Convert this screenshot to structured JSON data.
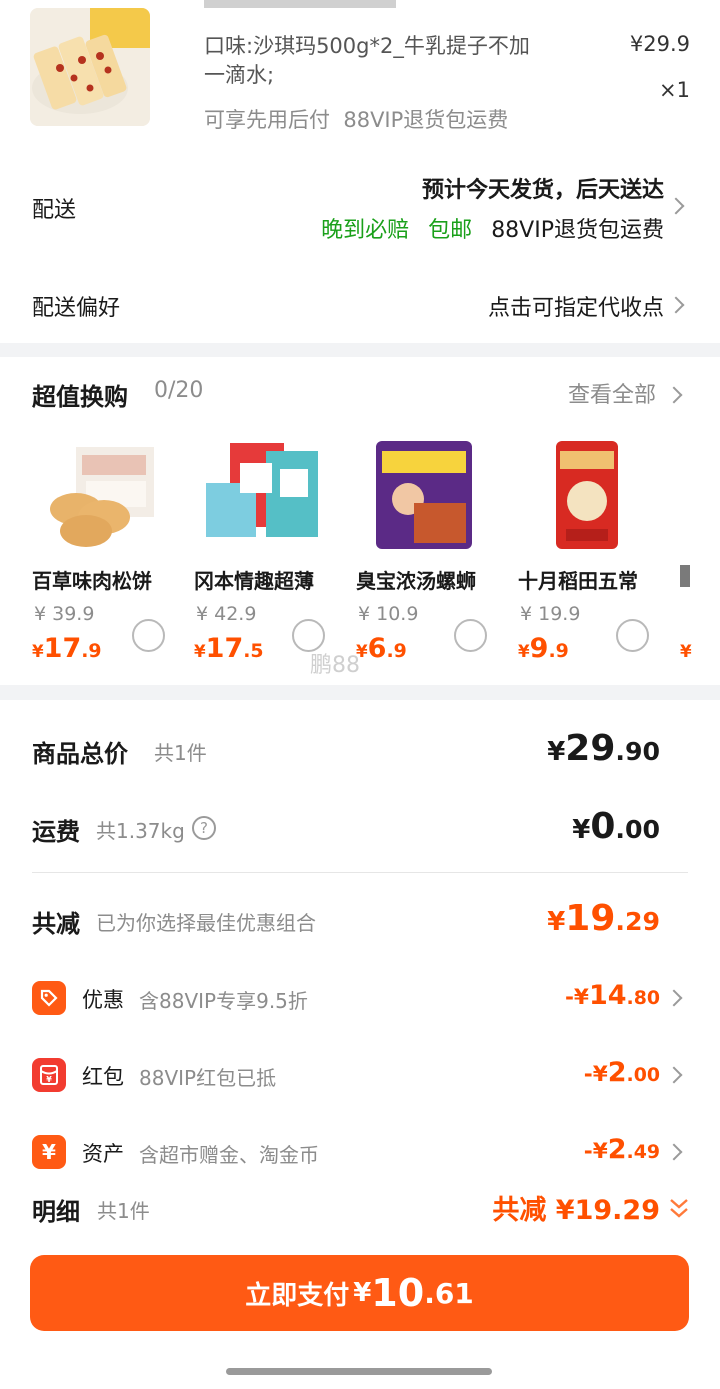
{
  "product": {
    "variant": "口味:沙琪玛500g*2_牛乳提子不加一滴水;",
    "variant_line1": "口味:沙琪玛500g*2_牛乳提子不加",
    "variant_line2": "一滴水;",
    "perks": "可享先用后付  88VIP退货包运费",
    "price": "¥29.9",
    "qty": "×1"
  },
  "delivery": {
    "label": "配送",
    "eta": "预计今天发货，后天送达",
    "tag_late": "晚到必赔",
    "tag_free": "包邮",
    "tag_return": "88VIP退货包运费"
  },
  "delivery_pref": {
    "label": "配送偏好",
    "value": "点击可指定代收点"
  },
  "exchange": {
    "title": "超值换购",
    "count": "0/20",
    "view_all": "查看全部",
    "items": [
      {
        "name": "百草味肉松饼",
        "orig": "¥ 39.9",
        "price_int": "17",
        "price_dec": ".9"
      },
      {
        "name": "冈本情趣超薄",
        "orig": "¥ 42.9",
        "price_int": "17",
        "price_dec": ".5"
      },
      {
        "name": "臭宝浓汤螺蛳",
        "orig": "¥ 10.9",
        "price_int": "6",
        "price_dec": ".9"
      },
      {
        "name": "十月稻田五常",
        "orig": "¥ 19.9",
        "price_int": "9",
        "price_dec": ".9"
      }
    ],
    "yen": "¥",
    "watermark": "鹏88"
  },
  "summary": {
    "total_label": "商品总价",
    "total_count": "共1件",
    "total_int": "29",
    "total_dec": ".90",
    "ship_label": "运费",
    "ship_weight": "共1.37kg",
    "ship_int": "0",
    "ship_dec": ".00",
    "reduce_label": "共减",
    "reduce_desc": "已为你选择最佳优惠组合",
    "reduce_int": "19",
    "reduce_dec": ".29",
    "discounts": [
      {
        "icon": "tag-icon",
        "label": "优惠",
        "desc": "含88VIP专享9.5折",
        "sign": "-¥",
        "int": "14",
        "dec": ".80"
      },
      {
        "icon": "red-packet-icon",
        "label": "红包",
        "desc": "88VIP红包已抵",
        "sign": "-¥",
        "int": "2",
        "dec": ".00"
      },
      {
        "icon": "yen-icon",
        "label": "资产",
        "desc": "含超市赠金、淘金币",
        "sign": "-¥",
        "int": "2",
        "dec": ".49"
      }
    ]
  },
  "footer": {
    "detail_label": "明细",
    "detail_count": "共1件",
    "detail_reduce": "共减 ¥19.29",
    "pay_label": "立即支付",
    "pay_yen": "¥",
    "pay_int": "10",
    "pay_dec": ".61"
  },
  "colors": {
    "accent": "#ff5000",
    "green": "#1aa01a",
    "button": "#ff5a14"
  }
}
